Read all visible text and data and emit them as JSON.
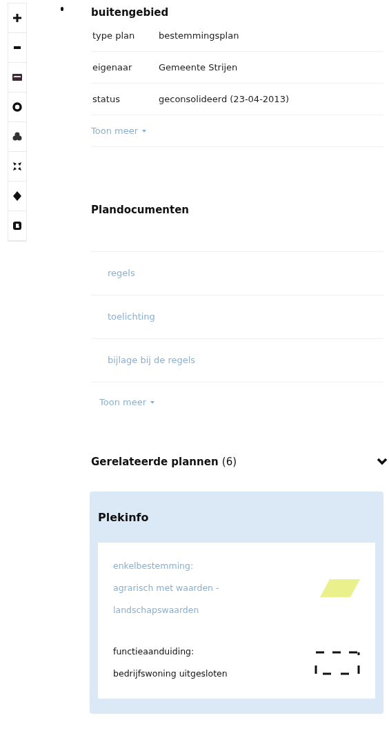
{
  "toolbar": [
    {
      "kind": "plus"
    },
    {
      "kind": "minus"
    },
    {
      "kind": "panel"
    },
    {
      "kind": "ring"
    },
    {
      "kind": "cluster"
    },
    {
      "kind": "expand"
    },
    {
      "kind": "diamond"
    },
    {
      "kind": "badge"
    }
  ],
  "plan": {
    "name": "buitengebied",
    "properties": [
      {
        "label": "type plan",
        "value": "bestemmingsplan"
      },
      {
        "label": "eigenaar",
        "value": "Gemeente Strijen"
      },
      {
        "label": "status",
        "value": "geconsolideerd (23-04-2013)"
      }
    ],
    "more": "Toon meer"
  },
  "documents": {
    "title": "Plandocumenten",
    "items": [
      "regels",
      "toelichting",
      "bijlage bij de regels"
    ],
    "more": "Toon meer"
  },
  "related": {
    "title": "Gerelateerde plannen",
    "count": "(6)",
    "expanded": false
  },
  "plekinfo": {
    "title": "Plekinfo",
    "items": [
      {
        "kind": "area",
        "lines": [
          "enkelbestemming:",
          "agrarisch met waarden -",
          "landschapswaarden"
        ]
      },
      {
        "kind": "outline",
        "lines": [
          "functieaanduiding:",
          "bedrijfswoning uitgesloten"
        ]
      }
    ]
  }
}
